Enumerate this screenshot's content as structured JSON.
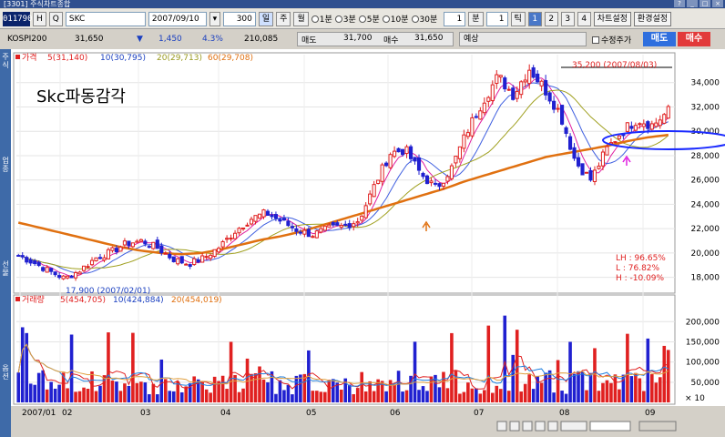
{
  "window": {
    "title": "[3301] 주식차트종합"
  },
  "toolbar": {
    "code": "011790",
    "h_button": "H",
    "search_button": "Q",
    "stock_name": "SKC",
    "date": "2007/09/10",
    "count": "300",
    "period_buttons": [
      "일",
      "주",
      "월"
    ],
    "minute_options": [
      "1분",
      "3분",
      "5분",
      "10분",
      "30분"
    ],
    "minute_value": "1",
    "minute_unit": "분",
    "tick_value": "1",
    "tick_unit": "틱",
    "layout_buttons": [
      "1",
      "2",
      "3",
      "4"
    ],
    "chart_settings": "차트설정",
    "env_settings": "환경설정"
  },
  "quote": {
    "index": "KOSPI200",
    "price": "31,650",
    "change_arrow": "▼",
    "change": "1,450",
    "rate": "4.3%",
    "volume": "210,085",
    "ask_label": "매도",
    "ask_value": "31,700",
    "bid_label": "매수",
    "bid_value": "31,650",
    "expect_label": "예상",
    "adjusted_label": "수정주가",
    "buy_button": "매도",
    "sell_button": "매수"
  },
  "left_tabs": [
    "주식",
    "업종",
    "선물",
    "옵션"
  ],
  "price_panel": {
    "legend": {
      "price": "가격",
      "ma5": "5(31,140)",
      "ma10": "10(30,795)",
      "ma20": "20(29,713)",
      "ma60": "60(29,708)"
    },
    "annotation": "Skc파동감각",
    "high_label": "35,200 (2007/08/03)",
    "low_label": "17,900 (2007/02/01)",
    "stats": {
      "lh": "LH :  96.65%",
      "l": "L  :  76.82%",
      "h": "H  : -10.09%"
    }
  },
  "volume_panel": {
    "legend": {
      "title": "거래량",
      "ma5": "5(454,705)",
      "ma10": "10(424,884)",
      "ma20": "20(454,019)"
    },
    "unit": "× 10"
  },
  "chart_data": [
    {
      "type": "candlestick",
      "title": "",
      "y_ticks": [
        18000,
        20000,
        22000,
        24000,
        26000,
        28000,
        30000,
        32000,
        34000
      ],
      "ylim": [
        17000,
        36300
      ],
      "x_ticks": [
        "2007/01",
        "02",
        "03",
        "04",
        "05",
        "06",
        "07",
        "08",
        "09"
      ],
      "series_close_approx": [
        19800,
        19200,
        18500,
        17900,
        18600,
        19600,
        20100,
        20800,
        21000,
        20400,
        19500,
        19100,
        19600,
        20500,
        21800,
        22800,
        23300,
        22600,
        21900,
        21500,
        22000,
        22200,
        22700,
        25500,
        28200,
        28500,
        26500,
        25300,
        27000,
        30000,
        32500,
        34500,
        33000,
        35200,
        33500,
        31500,
        27500,
        26000,
        28500,
        30000,
        31000,
        30500,
        31650
      ],
      "ma60_approx": [
        22500,
        22100,
        21700,
        21300,
        20900,
        20500,
        20200,
        20000,
        19900,
        20000,
        20300,
        20700,
        21100,
        21400,
        21800,
        22300,
        22800,
        23300,
        23800,
        24300,
        24800,
        25300,
        25900,
        26400,
        26900,
        27400,
        27900,
        28200,
        28500,
        28800,
        29200,
        29500,
        29708
      ]
    },
    {
      "type": "bar",
      "title": "",
      "y_ticks": [
        50000,
        100000,
        150000,
        200000
      ],
      "ylim": [
        0,
        230000
      ],
      "series_red_blue": "red = up day, blue = down day"
    }
  ],
  "bottom_toolbar_icons": [
    "zoom-in",
    "zoom-out",
    "zoom-reset",
    "cross",
    "scroll",
    "line-style"
  ]
}
